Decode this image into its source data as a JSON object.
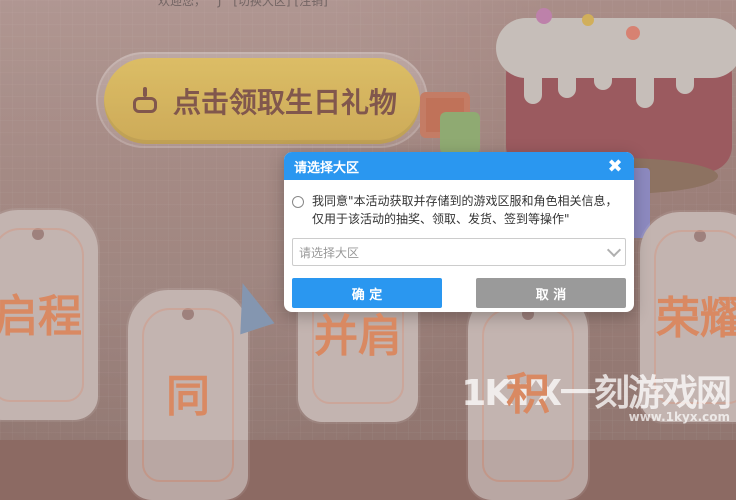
{
  "top_bar": {
    "greeting": "欢迎您，",
    "mask": "J",
    "logout": "[切换大区]",
    "register": "[注销]"
  },
  "gift_button": {
    "label": "点击领取生日礼物",
    "icon": "birthday-cake-icon"
  },
  "tags": [
    {
      "text": "启程"
    },
    {
      "text": "同"
    },
    {
      "text": "并肩"
    },
    {
      "text": "积"
    },
    {
      "text": "荣耀"
    }
  ],
  "modal": {
    "title": "请选择大区",
    "close_icon": "close-icon",
    "agreement": "我同意\"本活动获取并存储到的游戏区服和角色相关信息，\n仅用于该活动的抽奖、领取、发货、签到等操作\"",
    "select_placeholder": "请选择大区",
    "confirm": "确 定",
    "cancel": "取 消"
  },
  "watermark": {
    "brand": "一刻游戏网",
    "logo": "1KYX",
    "url": "www.1kyx.com"
  },
  "colors": {
    "accent": "#2a97f0",
    "cancel": "#9a9a9a",
    "gift_button": "#c9a23f"
  }
}
